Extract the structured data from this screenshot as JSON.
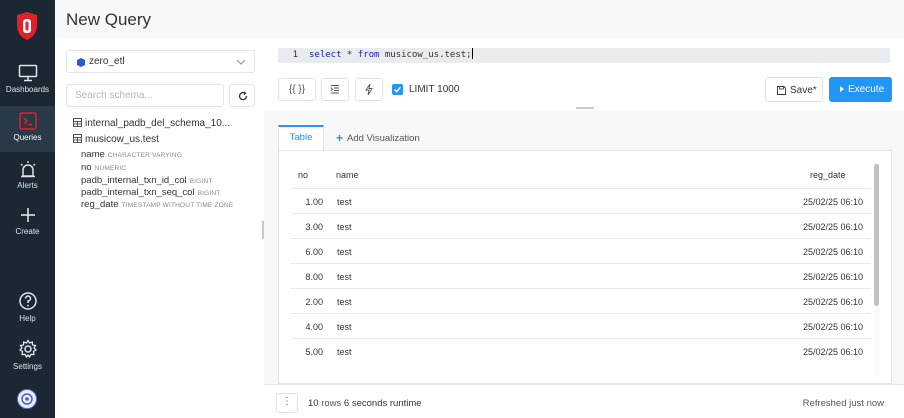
{
  "header": {
    "title": "New Query"
  },
  "nav": [
    {
      "label": "Dashboards",
      "icon": "monitor-icon"
    },
    {
      "label": "Queries",
      "icon": "terminal-icon",
      "active": true
    },
    {
      "label": "Alerts",
      "icon": "siren-icon"
    },
    {
      "label": "Create",
      "icon": "plus-icon"
    },
    {
      "label": "Help",
      "icon": "help-icon"
    },
    {
      "label": "Settings",
      "icon": "gear-icon"
    }
  ],
  "schema": {
    "datasource": "zero_etl",
    "search_placeholder": "Search schema...",
    "tables": [
      {
        "name": "internal_padb_del_schema_10..."
      },
      {
        "name": "musicow_us.test",
        "columns": [
          {
            "name": "name",
            "type": "CHARACTER VARYING"
          },
          {
            "name": "no",
            "type": "NUMERIC"
          },
          {
            "name": "padb_internal_txn_id_col",
            "type": "BIGINT"
          },
          {
            "name": "padb_internal_txn_seq_col",
            "type": "BIGINT"
          },
          {
            "name": "reg_date",
            "type": "TIMESTAMP WITHOUT TIME ZONE"
          }
        ]
      }
    ]
  },
  "editor": {
    "line_number": "1",
    "kw1": "select",
    "mid1": " * ",
    "kw2": "from",
    "rest": " musicow_us.test;"
  },
  "toolbar": {
    "params_label": "{{ }}",
    "limit_label": "LIMIT 1000",
    "limit_checked": true,
    "save_label": "Save*",
    "execute_label": "Execute"
  },
  "results": {
    "tabs": {
      "table": "Table",
      "add_viz": "Add Visualization"
    },
    "columns": [
      "no",
      "name",
      "reg_date"
    ],
    "rows": [
      [
        "1.00",
        "test",
        "25/02/25 06:10"
      ],
      [
        "3.00",
        "test",
        "25/02/25 06:10"
      ],
      [
        "6.00",
        "test",
        "25/02/25 06:10"
      ],
      [
        "8.00",
        "test",
        "25/02/25 06:10"
      ],
      [
        "2.00",
        "test",
        "25/02/25 06:10"
      ],
      [
        "4.00",
        "test",
        "25/02/25 06:10"
      ],
      [
        "5.00",
        "test",
        "25/02/25 06:10"
      ]
    ]
  },
  "footer": {
    "rows_count": "10",
    "rows_word": "rows",
    "runtime": "6 seconds runtime",
    "refreshed": "Refreshed just now"
  },
  "colors": {
    "nav_bg": "#1b2733",
    "accent": "#2196f3",
    "logo_red": "#e0202b"
  }
}
